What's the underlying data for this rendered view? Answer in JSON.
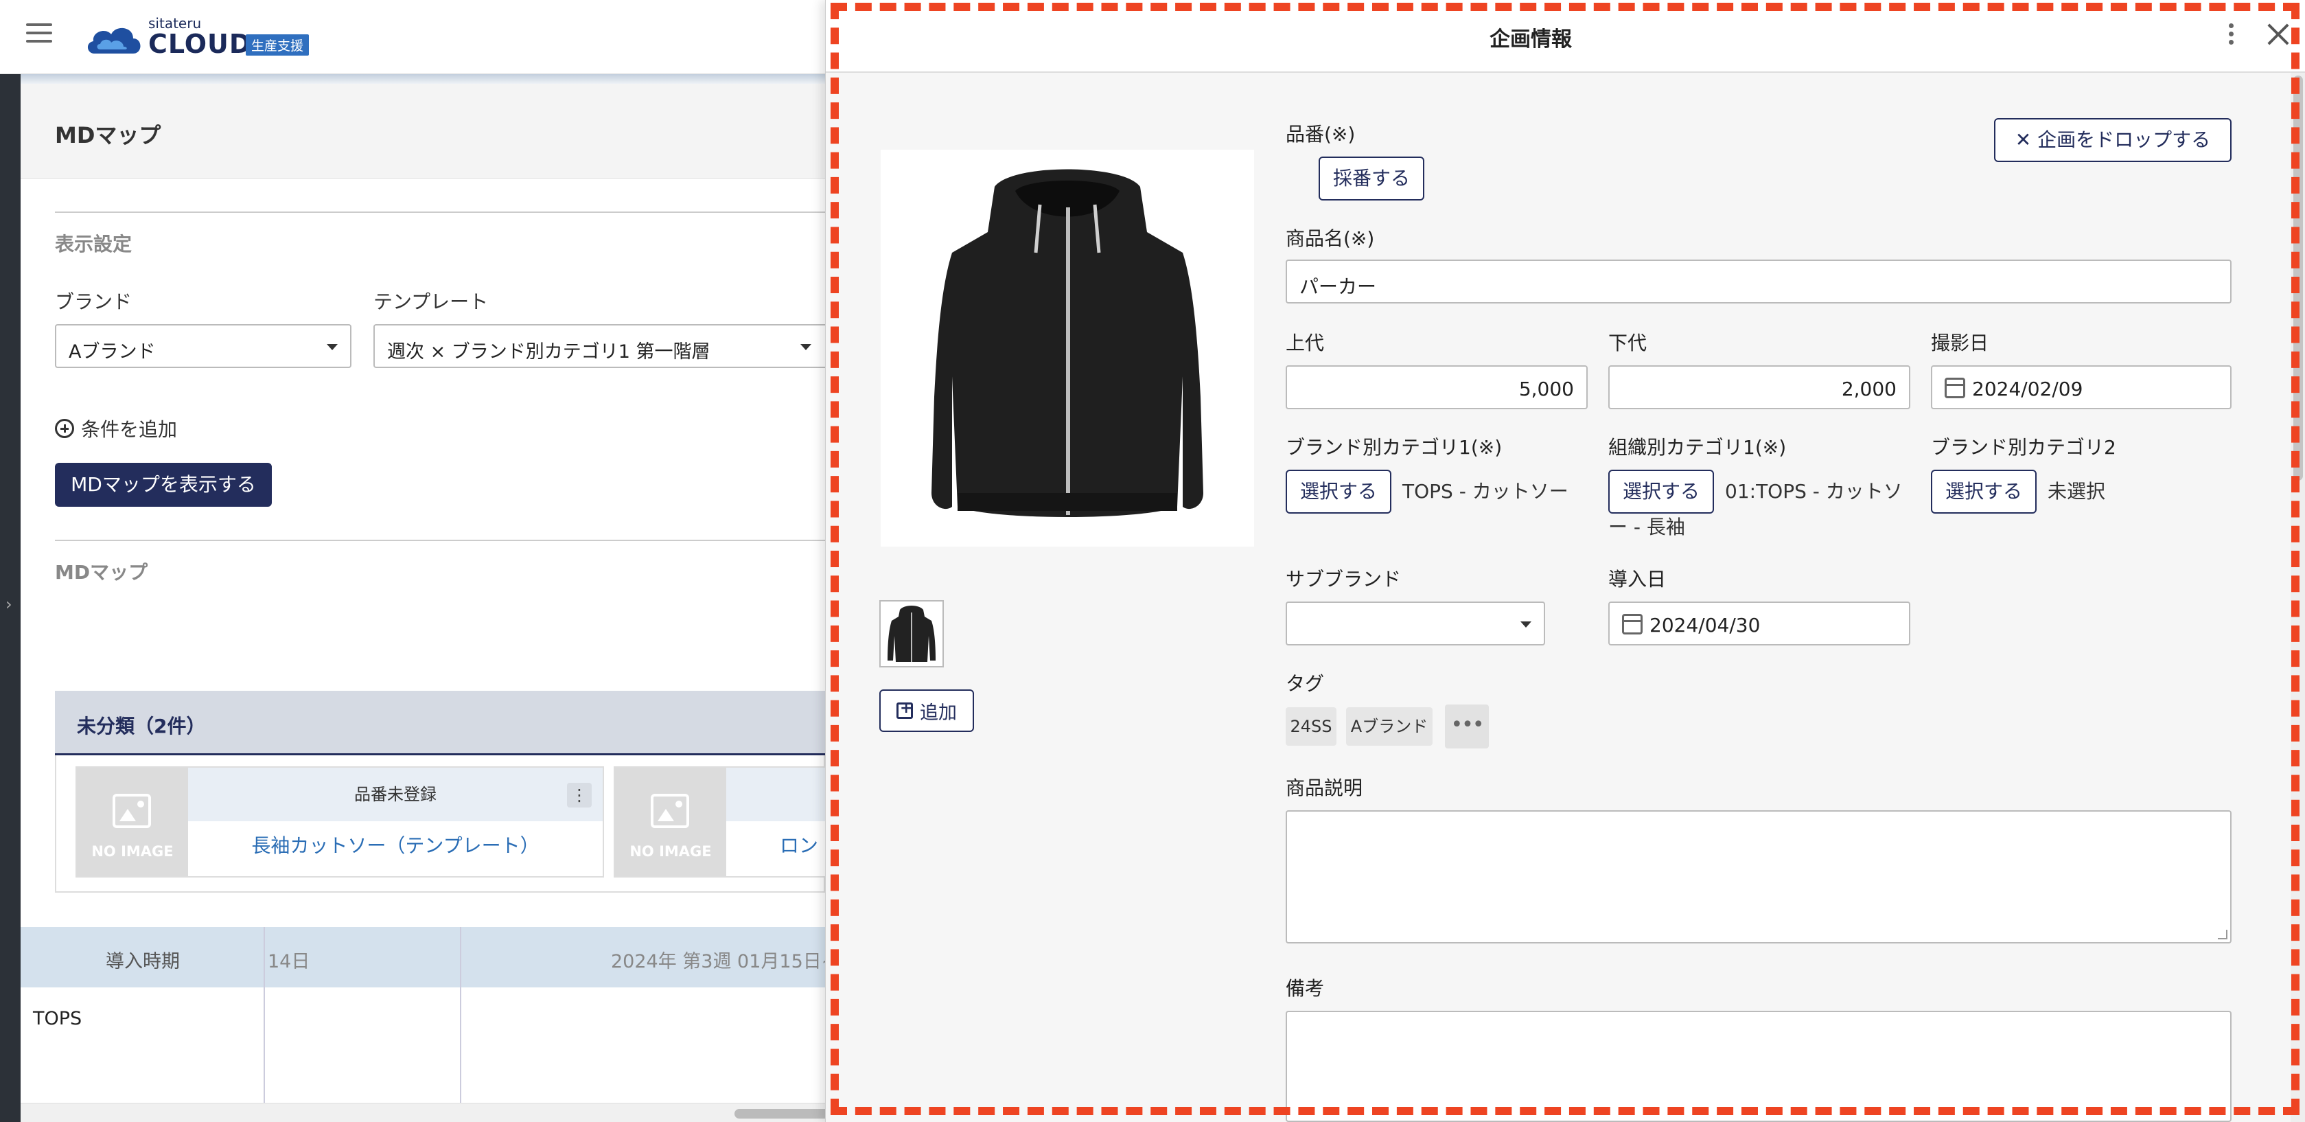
{
  "app": {
    "logo_small": "sitateru",
    "logo_main": "CLOUD",
    "logo_badge": "生産支援"
  },
  "left": {
    "page_title": "MDマップ",
    "display_settings": "表示設定",
    "brand_label": "ブランド",
    "brand_value": "Aブランド",
    "template_label": "テンプレート",
    "template_value": "週次 × ブランド別カテゴリ1 第一階層",
    "add_condition": "条件を追加",
    "show_button": "MDマップを表示する",
    "md_map_section": "MDマップ",
    "unclassified": "未分類（2件）",
    "cards": [
      {
        "header": "品番未登録",
        "name": "長袖カットソー（テンプレート）",
        "noimage": "NO IMAGE"
      },
      {
        "header": "",
        "name": "ロン",
        "noimage": "NO IMAGE"
      }
    ],
    "table": {
      "col1": "導入時期",
      "col2": "14日",
      "col3": "2024年 第3週 01月15日~",
      "row1": "TOPS"
    }
  },
  "panel": {
    "title": "企画情報",
    "drop_button": "企画をドロップする",
    "hinban_label": "品番(※)",
    "saiban_button": "採番する",
    "product_name_label": "商品名(※)",
    "product_name_value": "パーカー",
    "jodai_label": "上代",
    "jodai_value": "5,000",
    "gedai_label": "下代",
    "gedai_value": "2,000",
    "shoot_date_label": "撮影日",
    "shoot_date_value": "2024/02/09",
    "brand_cat1_label": "ブランド別カテゴリ1(※)",
    "brand_cat1_value": "TOPS - カットソー",
    "org_cat1_label": "組織別カテゴリ1(※)",
    "org_cat1_value_line1": "01:TOPS - カットソ",
    "org_cat1_value_line2": "ー - 長袖",
    "brand_cat2_label": "ブランド別カテゴリ2",
    "brand_cat2_value": "未選択",
    "select_button": "選択する",
    "subbrand_label": "サブブランド",
    "subbrand_value": "",
    "intro_date_label": "導入日",
    "intro_date_value": "2024/04/30",
    "tags_label": "タグ",
    "tags": [
      "24SS",
      "Aブランド"
    ],
    "tag_more": "•••",
    "desc_label": "商品説明",
    "notes_label": "備考",
    "add_image": "追加"
  },
  "colors": {
    "primary": "#232d5c",
    "highlight_dash": "#ee4422",
    "link": "#2a6db5"
  }
}
